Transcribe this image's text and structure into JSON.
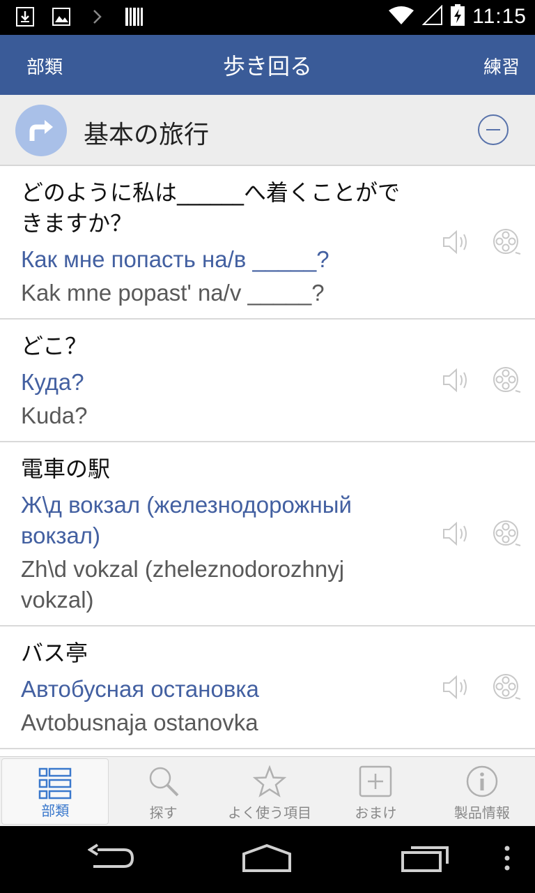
{
  "status_bar": {
    "time": "11:15",
    "left_icons": [
      "download-icon",
      "image-icon",
      "chevron-right-icon",
      "barcode-icon"
    ],
    "right_icons": [
      "wifi-icon",
      "signal-icon",
      "battery-charging-icon"
    ]
  },
  "action_bar": {
    "left_label": "部類",
    "title": "歩き回る",
    "right_label": "練習"
  },
  "category": {
    "title": "基本の旅行",
    "icon": "arrow-turn-right-icon",
    "action_icon": "collapse-minus-icon"
  },
  "phrases": [
    {
      "jp": "どのように私は______へ着くことができますか？",
      "ru": "Как мне попасть на/в _____?",
      "translit": "Kak mne popast' na/v _____?"
    },
    {
      "jp": "どこ？",
      "ru": "Куда?",
      "translit": "Kuda?"
    },
    {
      "jp": "電車の駅",
      "ru": "Ж\\д вокзал (железнодорожный вокзал)",
      "translit": "Zh\\d vokzal (zheleznodorozhnyj vokzal)"
    },
    {
      "jp": "バス亭",
      "ru": "Автобусная остановка",
      "translit": "Avtobusnaja ostanovka"
    }
  ],
  "tabs": [
    {
      "label": "部類",
      "icon": "list-icon",
      "active": true
    },
    {
      "label": "探す",
      "icon": "search-icon",
      "active": false
    },
    {
      "label": "よく使う項目",
      "icon": "star-icon",
      "active": false
    },
    {
      "label": "おまけ",
      "icon": "plus-box-icon",
      "active": false
    },
    {
      "label": "製品情報",
      "icon": "info-icon",
      "active": false
    }
  ],
  "nav_bar": {
    "buttons": [
      "back-icon",
      "home-icon",
      "recents-icon",
      "menu-icon"
    ]
  },
  "colors": {
    "accent": "#3a5b98",
    "russian_text": "#4360a1",
    "active_tab": "#3a78cc"
  }
}
